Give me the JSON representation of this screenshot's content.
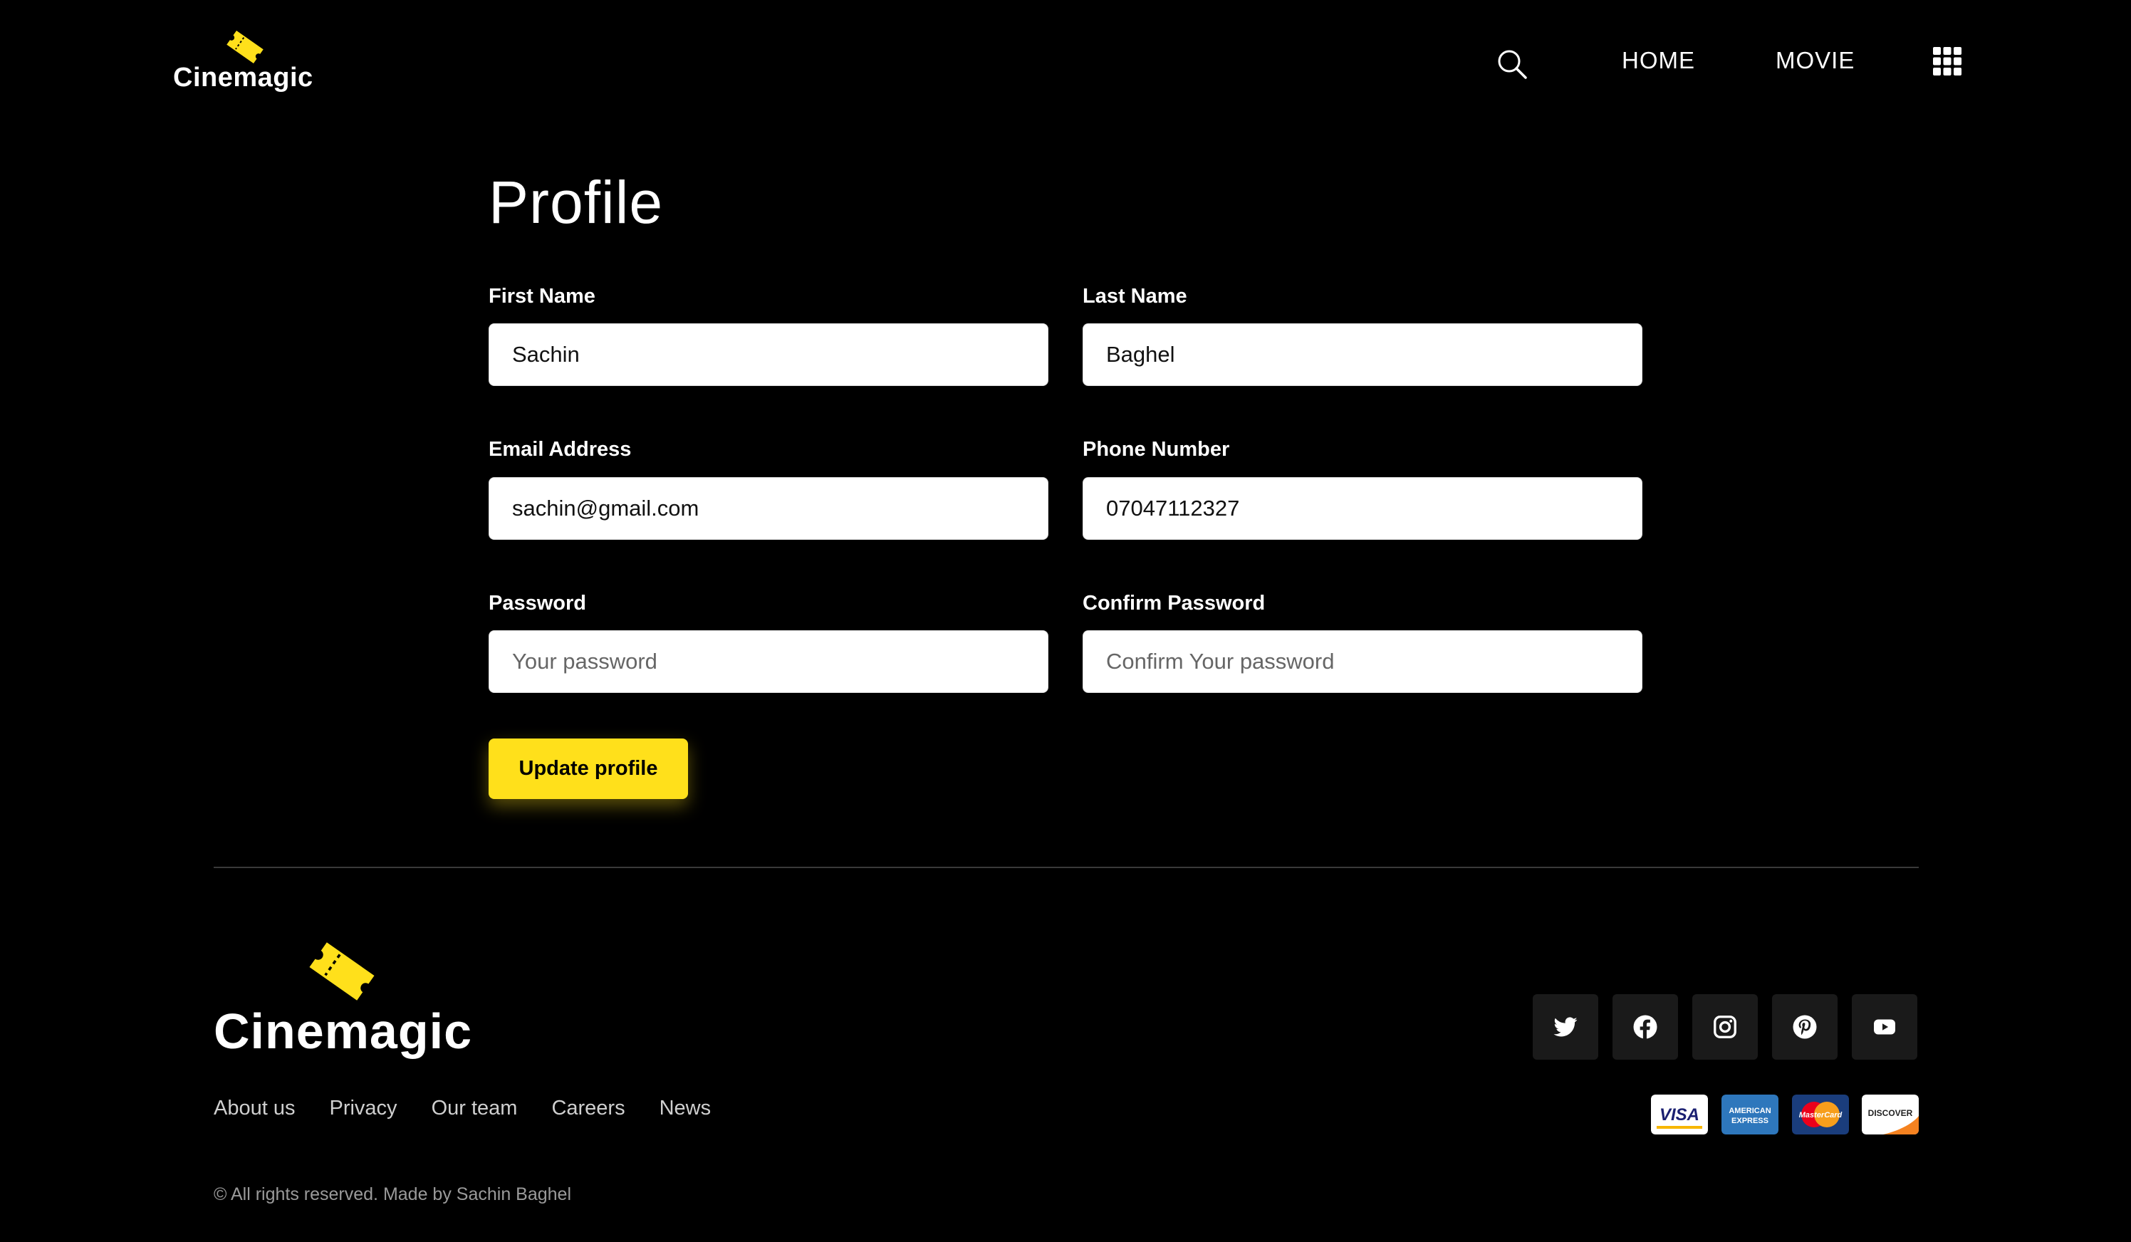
{
  "brand": {
    "name": "Cinemagic",
    "accent_color": "#ffe01b"
  },
  "header": {
    "search_icon": "search-icon",
    "nav": [
      {
        "label": "HOME"
      },
      {
        "label": "MOVIE"
      }
    ],
    "menu_icon": "grid-icon"
  },
  "profile": {
    "title": "Profile",
    "fields": {
      "first_name": {
        "label": "First Name",
        "value": "Sachin",
        "placeholder": ""
      },
      "last_name": {
        "label": "Last Name",
        "value": "Baghel",
        "placeholder": ""
      },
      "email": {
        "label": "Email Address",
        "value": "sachin@gmail.com",
        "placeholder": ""
      },
      "phone": {
        "label": "Phone Number",
        "value": "07047112327",
        "placeholder": ""
      },
      "password": {
        "label": "Password",
        "value": "",
        "placeholder": "Your password"
      },
      "confirm_password": {
        "label": "Confirm Password",
        "value": "",
        "placeholder": "Confirm Your password"
      }
    },
    "submit_label": "Update profile"
  },
  "footer": {
    "brand_name": "Cinemagic",
    "links": [
      {
        "label": "About us"
      },
      {
        "label": "Privacy"
      },
      {
        "label": "Our team"
      },
      {
        "label": "Careers"
      },
      {
        "label": "News"
      }
    ],
    "copyright": "© All rights reserved. Made by Sachin Baghel",
    "social_icons": [
      "twitter-icon",
      "facebook-icon",
      "instagram-icon",
      "pinterest-icon",
      "youtube-icon"
    ],
    "payment_cards": {
      "visa": "VISA",
      "amex_line1": "AMERICAN",
      "amex_line2": "EXPRESS",
      "mastercard": "MasterCard",
      "discover": "DISCOVER"
    }
  }
}
